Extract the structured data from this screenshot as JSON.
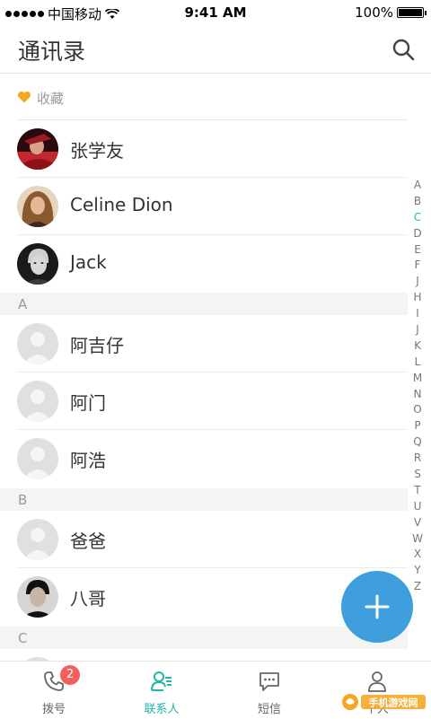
{
  "status_bar": {
    "carrier": "中国移动",
    "time": "9:41 AM",
    "battery": "100%"
  },
  "header": {
    "title": "通讯录",
    "search_icon": "search-icon"
  },
  "favorites": {
    "label": "收藏",
    "contacts": [
      {
        "name": "张学友"
      },
      {
        "name": "Celine Dion"
      },
      {
        "name": "Jack"
      }
    ]
  },
  "sections": [
    {
      "letter": "A",
      "contacts": [
        {
          "name": "阿吉仔"
        },
        {
          "name": "阿门"
        },
        {
          "name": "阿浩"
        }
      ]
    },
    {
      "letter": "B",
      "contacts": [
        {
          "name": "爸爸"
        },
        {
          "name": "八哥"
        }
      ]
    },
    {
      "letter": "C",
      "contacts": []
    }
  ],
  "index_letters": [
    "A",
    "B",
    "C",
    "D",
    "E",
    "F",
    "J",
    "H",
    "I",
    "J",
    "K",
    "L",
    "M",
    "N",
    "O",
    "P",
    "Q",
    "R",
    "S",
    "T",
    "U",
    "V",
    "W",
    "X",
    "Y",
    "Z"
  ],
  "index_active": "C",
  "tabs": [
    {
      "label": "拨号",
      "icon": "phone-icon",
      "badge": "2"
    },
    {
      "label": "联系人",
      "icon": "contacts-icon",
      "active": true
    },
    {
      "label": "短信",
      "icon": "message-icon"
    },
    {
      "label": "个人",
      "icon": "profile-icon"
    }
  ],
  "colors": {
    "accent": "#1fb7a9",
    "fab": "#3e9fdc",
    "badge": "#f25f5c",
    "favorite": "#f5a623"
  },
  "watermark": "手机游戏网"
}
